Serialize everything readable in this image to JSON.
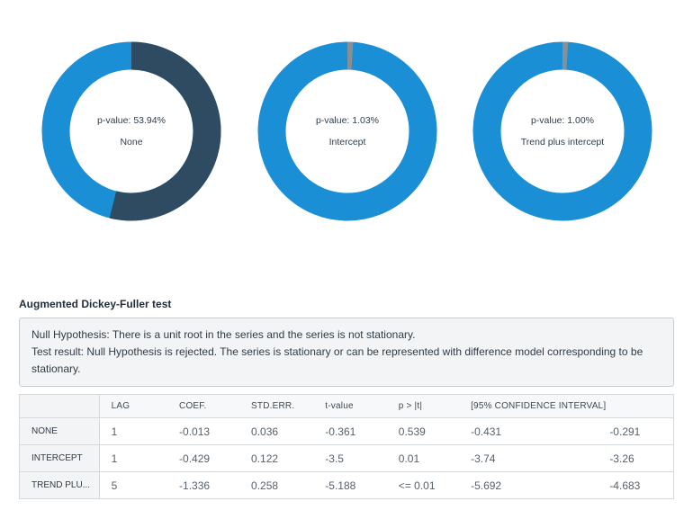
{
  "donuts": [
    {
      "pvalue_label": "p-value: 53.94%",
      "name": "None",
      "pvalue_fraction": 0.5394,
      "colors": {
        "fill": "#2e4b61",
        "rest": "#1b8fd6"
      }
    },
    {
      "pvalue_label": "p-value: 1.03%",
      "name": "Intercept",
      "pvalue_fraction": 0.0103,
      "colors": {
        "fill": "#8a8f95",
        "rest": "#1b8fd6"
      }
    },
    {
      "pvalue_label": "p-value: 1.00%",
      "name": "Trend plus intercept",
      "pvalue_fraction": 0.01,
      "colors": {
        "fill": "#8a8f95",
        "rest": "#1b8fd6"
      }
    }
  ],
  "section_title": "Augmented Dickey-Fuller test",
  "info": {
    "line1": "Null Hypothesis: There is a unit root in the series and the series is not stationary.",
    "line2": "Test result: Null Hypothesis is rejected. The series is stationary or can be represented with difference model corresponding to be stationary."
  },
  "table": {
    "headers": [
      "",
      "LAG",
      "COEF.",
      "STD.ERR.",
      "t-value",
      "p > |t|",
      "[95% CONFIDENCE INTERVAL]",
      ""
    ],
    "rows": [
      [
        "NONE",
        "1",
        "-0.013",
        "0.036",
        "-0.361",
        "0.539",
        "-0.431",
        "-0.291"
      ],
      [
        "INTERCEPT",
        "1",
        "-0.429",
        "0.122",
        "-3.5",
        "0.01",
        "-3.74",
        "-3.26"
      ],
      [
        "TREND PLU...",
        "5",
        "-1.336",
        "0.258",
        "-5.188",
        "<= 0.01",
        "-5.692",
        "-4.683"
      ]
    ]
  }
}
